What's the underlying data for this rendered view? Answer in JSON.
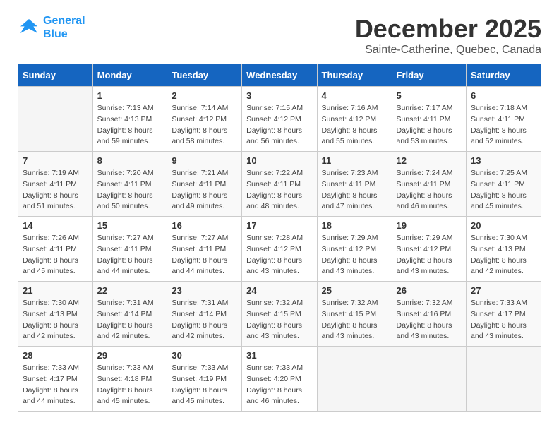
{
  "header": {
    "logo_line1": "General",
    "logo_line2": "Blue",
    "month_title": "December 2025",
    "location": "Sainte-Catherine, Quebec, Canada"
  },
  "weekdays": [
    "Sunday",
    "Monday",
    "Tuesday",
    "Wednesday",
    "Thursday",
    "Friday",
    "Saturday"
  ],
  "weeks": [
    [
      {
        "day": "",
        "sunrise": "",
        "sunset": "",
        "daylight": ""
      },
      {
        "day": "1",
        "sunrise": "Sunrise: 7:13 AM",
        "sunset": "Sunset: 4:13 PM",
        "daylight": "Daylight: 8 hours and 59 minutes."
      },
      {
        "day": "2",
        "sunrise": "Sunrise: 7:14 AM",
        "sunset": "Sunset: 4:12 PM",
        "daylight": "Daylight: 8 hours and 58 minutes."
      },
      {
        "day": "3",
        "sunrise": "Sunrise: 7:15 AM",
        "sunset": "Sunset: 4:12 PM",
        "daylight": "Daylight: 8 hours and 56 minutes."
      },
      {
        "day": "4",
        "sunrise": "Sunrise: 7:16 AM",
        "sunset": "Sunset: 4:12 PM",
        "daylight": "Daylight: 8 hours and 55 minutes."
      },
      {
        "day": "5",
        "sunrise": "Sunrise: 7:17 AM",
        "sunset": "Sunset: 4:11 PM",
        "daylight": "Daylight: 8 hours and 53 minutes."
      },
      {
        "day": "6",
        "sunrise": "Sunrise: 7:18 AM",
        "sunset": "Sunset: 4:11 PM",
        "daylight": "Daylight: 8 hours and 52 minutes."
      }
    ],
    [
      {
        "day": "7",
        "sunrise": "Sunrise: 7:19 AM",
        "sunset": "Sunset: 4:11 PM",
        "daylight": "Daylight: 8 hours and 51 minutes."
      },
      {
        "day": "8",
        "sunrise": "Sunrise: 7:20 AM",
        "sunset": "Sunset: 4:11 PM",
        "daylight": "Daylight: 8 hours and 50 minutes."
      },
      {
        "day": "9",
        "sunrise": "Sunrise: 7:21 AM",
        "sunset": "Sunset: 4:11 PM",
        "daylight": "Daylight: 8 hours and 49 minutes."
      },
      {
        "day": "10",
        "sunrise": "Sunrise: 7:22 AM",
        "sunset": "Sunset: 4:11 PM",
        "daylight": "Daylight: 8 hours and 48 minutes."
      },
      {
        "day": "11",
        "sunrise": "Sunrise: 7:23 AM",
        "sunset": "Sunset: 4:11 PM",
        "daylight": "Daylight: 8 hours and 47 minutes."
      },
      {
        "day": "12",
        "sunrise": "Sunrise: 7:24 AM",
        "sunset": "Sunset: 4:11 PM",
        "daylight": "Daylight: 8 hours and 46 minutes."
      },
      {
        "day": "13",
        "sunrise": "Sunrise: 7:25 AM",
        "sunset": "Sunset: 4:11 PM",
        "daylight": "Daylight: 8 hours and 45 minutes."
      }
    ],
    [
      {
        "day": "14",
        "sunrise": "Sunrise: 7:26 AM",
        "sunset": "Sunset: 4:11 PM",
        "daylight": "Daylight: 8 hours and 45 minutes."
      },
      {
        "day": "15",
        "sunrise": "Sunrise: 7:27 AM",
        "sunset": "Sunset: 4:11 PM",
        "daylight": "Daylight: 8 hours and 44 minutes."
      },
      {
        "day": "16",
        "sunrise": "Sunrise: 7:27 AM",
        "sunset": "Sunset: 4:11 PM",
        "daylight": "Daylight: 8 hours and 44 minutes."
      },
      {
        "day": "17",
        "sunrise": "Sunrise: 7:28 AM",
        "sunset": "Sunset: 4:12 PM",
        "daylight": "Daylight: 8 hours and 43 minutes."
      },
      {
        "day": "18",
        "sunrise": "Sunrise: 7:29 AM",
        "sunset": "Sunset: 4:12 PM",
        "daylight": "Daylight: 8 hours and 43 minutes."
      },
      {
        "day": "19",
        "sunrise": "Sunrise: 7:29 AM",
        "sunset": "Sunset: 4:12 PM",
        "daylight": "Daylight: 8 hours and 43 minutes."
      },
      {
        "day": "20",
        "sunrise": "Sunrise: 7:30 AM",
        "sunset": "Sunset: 4:13 PM",
        "daylight": "Daylight: 8 hours and 42 minutes."
      }
    ],
    [
      {
        "day": "21",
        "sunrise": "Sunrise: 7:30 AM",
        "sunset": "Sunset: 4:13 PM",
        "daylight": "Daylight: 8 hours and 42 minutes."
      },
      {
        "day": "22",
        "sunrise": "Sunrise: 7:31 AM",
        "sunset": "Sunset: 4:14 PM",
        "daylight": "Daylight: 8 hours and 42 minutes."
      },
      {
        "day": "23",
        "sunrise": "Sunrise: 7:31 AM",
        "sunset": "Sunset: 4:14 PM",
        "daylight": "Daylight: 8 hours and 42 minutes."
      },
      {
        "day": "24",
        "sunrise": "Sunrise: 7:32 AM",
        "sunset": "Sunset: 4:15 PM",
        "daylight": "Daylight: 8 hours and 43 minutes."
      },
      {
        "day": "25",
        "sunrise": "Sunrise: 7:32 AM",
        "sunset": "Sunset: 4:15 PM",
        "daylight": "Daylight: 8 hours and 43 minutes."
      },
      {
        "day": "26",
        "sunrise": "Sunrise: 7:32 AM",
        "sunset": "Sunset: 4:16 PM",
        "daylight": "Daylight: 8 hours and 43 minutes."
      },
      {
        "day": "27",
        "sunrise": "Sunrise: 7:33 AM",
        "sunset": "Sunset: 4:17 PM",
        "daylight": "Daylight: 8 hours and 43 minutes."
      }
    ],
    [
      {
        "day": "28",
        "sunrise": "Sunrise: 7:33 AM",
        "sunset": "Sunset: 4:17 PM",
        "daylight": "Daylight: 8 hours and 44 minutes."
      },
      {
        "day": "29",
        "sunrise": "Sunrise: 7:33 AM",
        "sunset": "Sunset: 4:18 PM",
        "daylight": "Daylight: 8 hours and 45 minutes."
      },
      {
        "day": "30",
        "sunrise": "Sunrise: 7:33 AM",
        "sunset": "Sunset: 4:19 PM",
        "daylight": "Daylight: 8 hours and 45 minutes."
      },
      {
        "day": "31",
        "sunrise": "Sunrise: 7:33 AM",
        "sunset": "Sunset: 4:20 PM",
        "daylight": "Daylight: 8 hours and 46 minutes."
      },
      {
        "day": "",
        "sunrise": "",
        "sunset": "",
        "daylight": ""
      },
      {
        "day": "",
        "sunrise": "",
        "sunset": "",
        "daylight": ""
      },
      {
        "day": "",
        "sunrise": "",
        "sunset": "",
        "daylight": ""
      }
    ]
  ]
}
